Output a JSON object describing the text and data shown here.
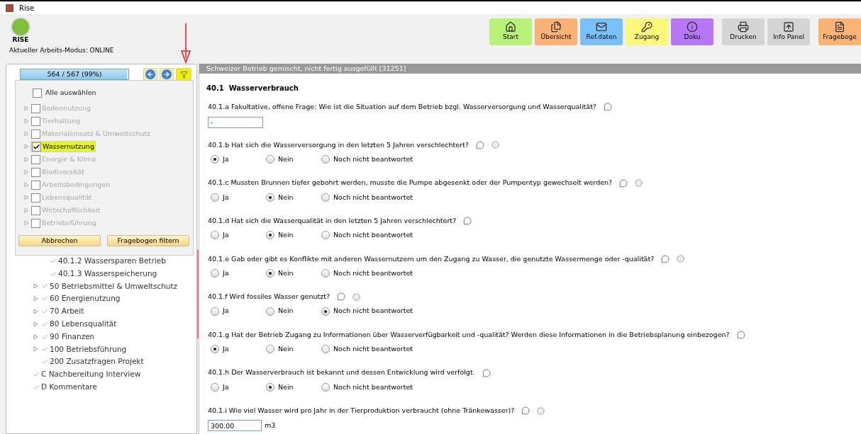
{
  "window": {
    "title": "Rise"
  },
  "logo": {
    "text": "RISE"
  },
  "mode": "Aktueller Arbeits-Modus: ONLINE",
  "toolbar": [
    {
      "label": "Start",
      "color": "#b9f27a"
    },
    {
      "label": "Übersicht",
      "color": "#fbb277"
    },
    {
      "label": "Ref.daten",
      "color": "#79c0fb"
    },
    {
      "label": "Zugang",
      "color": "#fbf77a"
    },
    {
      "label": "Doku",
      "color": "#b776f5"
    },
    {
      "label": "Drucken",
      "color": "#d4d4d4"
    },
    {
      "label": "Info Panel",
      "color": "#d4d4d4"
    },
    {
      "label": "Frageboge",
      "color": "#fbb277"
    }
  ],
  "progress": {
    "text": "564 / 567 (99%)",
    "level": 0.99
  },
  "filter_button": {
    "highlighted": true
  },
  "filter_menu": {
    "select_all": {
      "label": "Alle auswählen",
      "checked": false
    },
    "items": [
      {
        "label": "Bodennutzung",
        "checked": false,
        "highlighted": false
      },
      {
        "label": "Tierhaltung",
        "checked": false,
        "highlighted": false
      },
      {
        "label": "Materialeinsatz & Umweltschutz",
        "checked": false,
        "highlighted": false
      },
      {
        "label": "Wassernutzung",
        "checked": true,
        "highlighted": true
      },
      {
        "label": "Energie & Klima",
        "checked": false,
        "highlighted": false
      },
      {
        "label": "Biodiversität",
        "checked": false,
        "highlighted": false
      },
      {
        "label": "Arbeitsbedingungen",
        "checked": false,
        "highlighted": false
      },
      {
        "label": "Lebensqualität",
        "checked": false,
        "highlighted": false
      },
      {
        "label": "Wirtschaftlichkeit",
        "checked": false,
        "highlighted": false
      },
      {
        "label": "Betriebsführung",
        "checked": false,
        "highlighted": false
      }
    ],
    "buttons": [
      "Abbrechen",
      "Fragebogen filtern"
    ]
  },
  "tree": [
    {
      "children": [
        {
          "children": [
            {
              "label": "40.1.2 Wassersparen Betrieb",
              "done": true,
              "expandable": false
            },
            {
              "label": "40.1.3 Wasserspeicherung",
              "done": true,
              "expandable": false
            }
          ]
        },
        {
          "label": "50 Betriebsmittel & Umweltschutz",
          "done": true,
          "expandable": true
        },
        {
          "label": "60 Energienutzung",
          "done": true,
          "expandable": true
        },
        {
          "label": "70 Arbeit",
          "done": true,
          "expandable": true
        },
        {
          "label": "80 Lebensqualität",
          "done": true,
          "expandable": true
        },
        {
          "label": "90 Finanzen",
          "done": true,
          "expandable": true
        },
        {
          "label": "100 Betriebsführung",
          "done": true,
          "expandable": true
        },
        {
          "label": "200 Zusatzfragen Projekt",
          "done": true,
          "expandable": false
        }
      ]
    },
    {
      "label": "C Nachbereitung Interview",
      "done": true,
      "expandable": false
    },
    {
      "label": "D Kommentare",
      "done": true,
      "expandable": false
    }
  ],
  "content": {
    "header": "Schweizer Betrieb gemischt, nicht fertig ausgefüllt [31251]",
    "section": "40.1  Wasserverbrauch",
    "questions": [
      {
        "kind": "text",
        "text": "40.1.a Fakultative, offene Frage: Wie ist die Situation auf dem Betrieb bzgl. Wasserversorgung und Wasserqualität?",
        "info": false,
        "value": "-"
      },
      {
        "kind": "radio",
        "text": "40.1.b Hat sich die Wasserversorgung in den letzten 5 Jahren verschlechtert?",
        "info": true,
        "options": [
          {
            "label": "Ja",
            "selected": true
          },
          {
            "label": "Nein",
            "selected": false
          },
          {
            "label": "Noch nicht beantwortet",
            "selected": false
          }
        ]
      },
      {
        "kind": "radio",
        "text": "40.1.c Mussten Brunnen tiefer gebohrt werden, musste die Pumpe abgesenkt oder der Pumpentyp gewechselt werden?",
        "info": true,
        "options": [
          {
            "label": "Ja",
            "selected": false
          },
          {
            "label": "Nein",
            "selected": true
          },
          {
            "label": "Noch nicht beantwortet",
            "selected": false
          }
        ]
      },
      {
        "kind": "radio",
        "text": "40.1.d Hat sich die Wasserqualität in den letzten 5 Jahren verschlechtert?",
        "info": false,
        "options": [
          {
            "label": "Ja",
            "selected": false
          },
          {
            "label": "Nein",
            "selected": true
          },
          {
            "label": "Noch nicht beantwortet",
            "selected": false
          }
        ]
      },
      {
        "kind": "radio",
        "text": "40.1.e Gab oder gibt es Konflikte mit anderen Wassernutzern um den Zugang zu Wasser, die genutzte Wassermenge oder -qualität?",
        "info": true,
        "options": [
          {
            "label": "Ja",
            "selected": false
          },
          {
            "label": "Nein",
            "selected": true
          },
          {
            "label": "Noch nicht beantwortet",
            "selected": false
          }
        ]
      },
      {
        "kind": "radio",
        "text": "40.1.f Wird fossiles Wasser genutzt?",
        "info": true,
        "options": [
          {
            "label": "Ja",
            "selected": false
          },
          {
            "label": "Nein",
            "selected": false
          },
          {
            "label": "Noch nicht beantwortet",
            "selected": true
          }
        ]
      },
      {
        "kind": "radio",
        "text": "40.1.g Hat der Betrieb Zugang zu Informationen über Wasserverfügbarkeit und -qualität? Werden diese Informationen in die Betriebsplanung einbezogen?",
        "info": false,
        "options": [
          {
            "label": "Ja",
            "selected": true
          },
          {
            "label": "Nein",
            "selected": false
          },
          {
            "label": "Noch nicht beantwortet",
            "selected": false
          }
        ]
      },
      {
        "kind": "radio",
        "text": "40.1.h Der Wasserverbrauch ist bekannt und dessen Entwicklung wird verfolgt.",
        "info": false,
        "options": [
          {
            "label": "Ja",
            "selected": false
          },
          {
            "label": "Nein",
            "selected": true
          },
          {
            "label": "Noch nicht beantwortet",
            "selected": false
          }
        ]
      },
      {
        "kind": "number",
        "text": "40.1.i Wie viel Wasser wird pro Jahr in der Tierproduktion verbraucht (ohne Tränkewasser)?",
        "info": true,
        "value": "300.00",
        "unit": "m3"
      }
    ]
  }
}
